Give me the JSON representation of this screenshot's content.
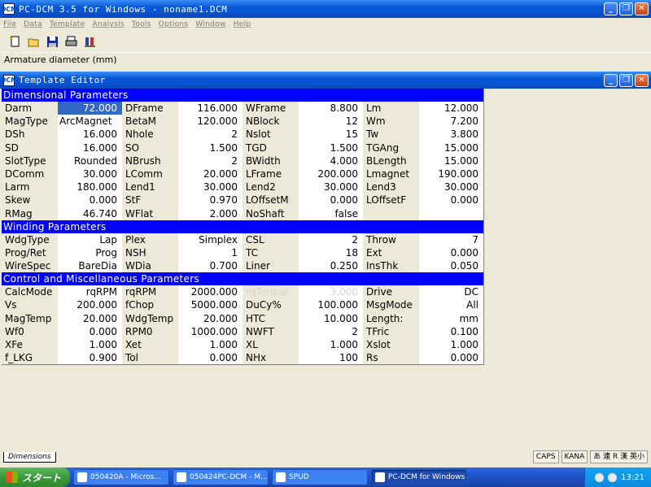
{
  "app": {
    "title": "PC-DCM 3.5 for Windows - noname1.DCM",
    "icon_label": "DCM",
    "menu": [
      "File",
      "Data",
      "Template",
      "Analysis",
      "Tools",
      "Options",
      "Window",
      "Help"
    ],
    "toolbar_icons": [
      "new-document-icon",
      "open-folder-icon",
      "save-disk-icon",
      "print-icon",
      "motor-icon"
    ],
    "status_text": "Armature diameter (mm)"
  },
  "editor": {
    "title": "Template Editor",
    "tab_label": "Dimensions",
    "sections": [
      {
        "title": "Dimensional Parameters",
        "rows": [
          [
            [
              "Darm",
              "72.000"
            ],
            [
              "DFrame",
              "116.000"
            ],
            [
              "WFrame",
              "8.800"
            ],
            [
              "Lm",
              "12.000"
            ]
          ],
          [
            [
              "MagType",
              "ArcMagnet"
            ],
            [
              "BetaM",
              "120.000"
            ],
            [
              "NBlock",
              "12"
            ],
            [
              "Wm",
              "7.200"
            ]
          ],
          [
            [
              "DSh",
              "16.000"
            ],
            [
              "Nhole",
              "2"
            ],
            [
              "Nslot",
              "15"
            ],
            [
              "Tw",
              "3.800"
            ]
          ],
          [
            [
              "SD",
              "16.000"
            ],
            [
              "SO",
              "1.500"
            ],
            [
              "TGD",
              "1.500"
            ],
            [
              "TGAng",
              "15.000"
            ]
          ],
          [
            [
              "SlotType",
              "Rounded"
            ],
            [
              "NBrush",
              "2"
            ],
            [
              "BWidth",
              "4.000"
            ],
            [
              "BLength",
              "15.000"
            ]
          ],
          [
            [
              "DComm",
              "30.000"
            ],
            [
              "LComm",
              "20.000"
            ],
            [
              "LFrame",
              "200.000"
            ],
            [
              "Lmagnet",
              "190.000"
            ]
          ],
          [
            [
              "Larm",
              "180.000"
            ],
            [
              "Lend1",
              "30.000"
            ],
            [
              "Lend2",
              "30.000"
            ],
            [
              "Lend3",
              "30.000"
            ]
          ],
          [
            [
              "Skew",
              "0.000"
            ],
            [
              "StF",
              "0.970"
            ],
            [
              "LOffsetM",
              "0.000"
            ],
            [
              "LOffsetF",
              "0.000"
            ]
          ],
          [
            [
              "RMag",
              "46.740"
            ],
            [
              "WFlat",
              "2.000"
            ],
            [
              "NoShaft",
              "false"
            ],
            [
              "",
              ""
            ]
          ]
        ]
      },
      {
        "title": "Winding Parameters",
        "rows": [
          [
            [
              "WdgType",
              "Lap"
            ],
            [
              "Plex",
              "Simplex"
            ],
            [
              "CSL",
              "2"
            ],
            [
              "Throw",
              "7"
            ]
          ],
          [
            [
              "Prog/Ret",
              "Prog"
            ],
            [
              "NSH",
              "1"
            ],
            [
              "TC",
              "18"
            ],
            [
              "Ext",
              "0.000"
            ]
          ],
          [
            [
              "WireSpec",
              "BareDia"
            ],
            [
              "WDia",
              "0.700"
            ],
            [
              "Liner",
              "0.250"
            ],
            [
              "InsThk",
              "0.050"
            ]
          ]
        ]
      },
      {
        "title": "Control and Miscellaneous Parameters",
        "rows": [
          [
            [
              "CalcMode",
              "rqRPM"
            ],
            [
              "rqRPM",
              "2000.000"
            ],
            [
              "rqTorque",
              "3.000"
            ],
            [
              "Drive",
              "DC"
            ]
          ],
          [
            [
              "Vs",
              "200.000"
            ],
            [
              "fChop",
              "5000.000"
            ],
            [
              "DuCy%",
              "100.000"
            ],
            [
              "MsgMode",
              "All"
            ]
          ],
          [
            [
              "MagTemp",
              "20.000"
            ],
            [
              "WdgTemp",
              "20.000"
            ],
            [
              "HTC",
              "10.000"
            ],
            [
              "Length:",
              "mm"
            ]
          ],
          [
            [
              "Wf0",
              "0.000"
            ],
            [
              "RPM0",
              "1000.000"
            ],
            [
              "NWFT",
              "2"
            ],
            [
              "TFric",
              "0.100"
            ]
          ],
          [
            [
              "XFe",
              "1.000"
            ],
            [
              "Xet",
              "1.000"
            ],
            [
              "XL",
              "1.000"
            ],
            [
              "Xslot",
              "1.000"
            ]
          ],
          [
            [
              "f_LKG",
              "0.900"
            ],
            [
              "Tol",
              "0.000"
            ],
            [
              "NHx",
              "100"
            ],
            [
              "Rs",
              "0.000"
            ]
          ]
        ]
      }
    ]
  },
  "tray_mini": {
    "caps": "CAPS",
    "kana": "KANA",
    "ime_text": "あ 連 R 漢 英小"
  },
  "taskbar": {
    "start_label": "スタート",
    "tasks": [
      "050420A - Micros...",
      "050424PC-DCM - M...",
      "SPUD",
      "PC-DCM for Windows"
    ],
    "clock": "13:21"
  }
}
